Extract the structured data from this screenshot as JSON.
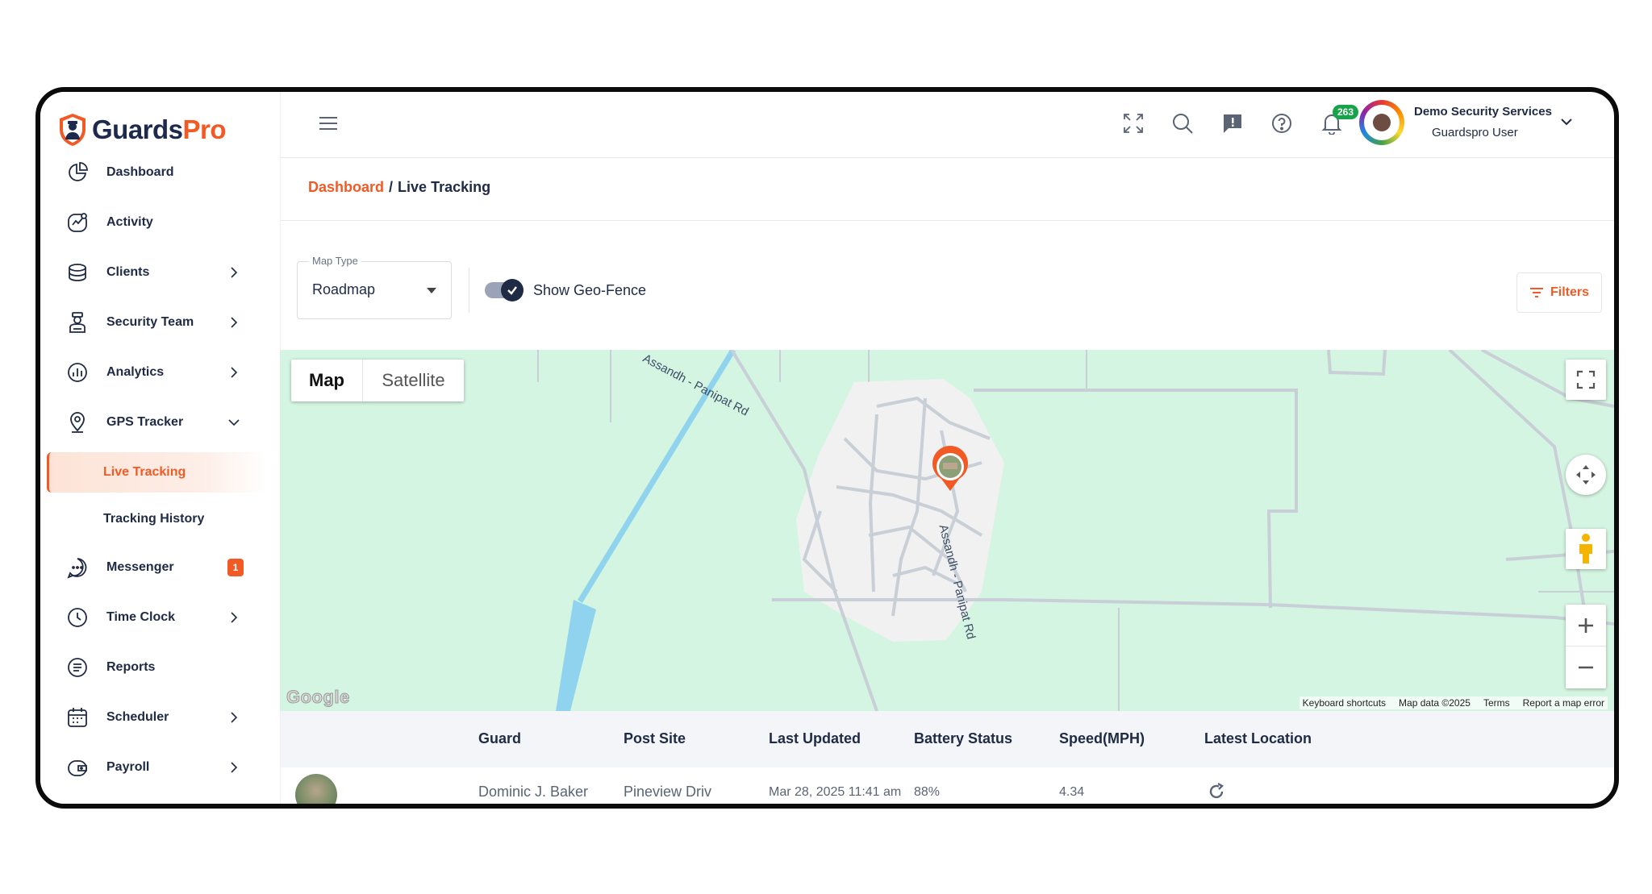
{
  "brand": {
    "part1": "Guards",
    "part2": "Pro"
  },
  "sidebar": {
    "items": [
      {
        "label": "Dashboard",
        "icon": "dashboard-icon"
      },
      {
        "label": "Activity",
        "icon": "activity-icon"
      },
      {
        "label": "Clients",
        "icon": "clients-icon"
      },
      {
        "label": "Security Team",
        "icon": "security-team-icon"
      },
      {
        "label": "Analytics",
        "icon": "analytics-icon"
      },
      {
        "label": "GPS Tracker",
        "icon": "location-pin-icon"
      },
      {
        "label": "Live Tracking"
      },
      {
        "label": "Tracking History"
      },
      {
        "label": "Messenger",
        "icon": "chat-icon",
        "badge": "1"
      },
      {
        "label": "Time Clock",
        "icon": "clock-icon"
      },
      {
        "label": "Reports",
        "icon": "reports-icon"
      },
      {
        "label": "Scheduler",
        "icon": "calendar-icon"
      },
      {
        "label": "Payroll",
        "icon": "wallet-icon"
      }
    ]
  },
  "topbar": {
    "notifications_count": "263",
    "company": "Demo Security Services",
    "role": "Guardspro User"
  },
  "breadcrumb": {
    "parent": "Dashboard",
    "separator": "/",
    "current": "Live Tracking"
  },
  "controls": {
    "map_type_label": "Map Type",
    "map_type_value": "Roadmap",
    "geofence_label": "Show Geo-Fence",
    "geofence_on": true,
    "filters_label": "Filters"
  },
  "map": {
    "map_btn": "Map",
    "satellite_btn": "Satellite",
    "road_label_1": "Assandh - Panipat Rd",
    "road_label_2": "Assandh - Panipat Rd",
    "google": "Google",
    "footer": [
      "Keyboard shortcuts",
      "Map data ©2025",
      "Terms",
      "Report a map error"
    ]
  },
  "table": {
    "headers": [
      "Guard",
      "Post Site",
      "Last Updated",
      "Battery Status",
      "Speed(MPH)",
      "Latest Location"
    ],
    "rows": [
      {
        "guard": "Dominic J. Baker",
        "post_site": "Pineview Driv",
        "last_updated": "Mar 28, 2025 11:41 am",
        "battery": "88%",
        "speed": "4.34"
      }
    ]
  },
  "colors": {
    "accent": "#f15a24",
    "navy": "#1f2a44",
    "map_green": "#d4f5e1",
    "notif_green": "#16a34a"
  }
}
